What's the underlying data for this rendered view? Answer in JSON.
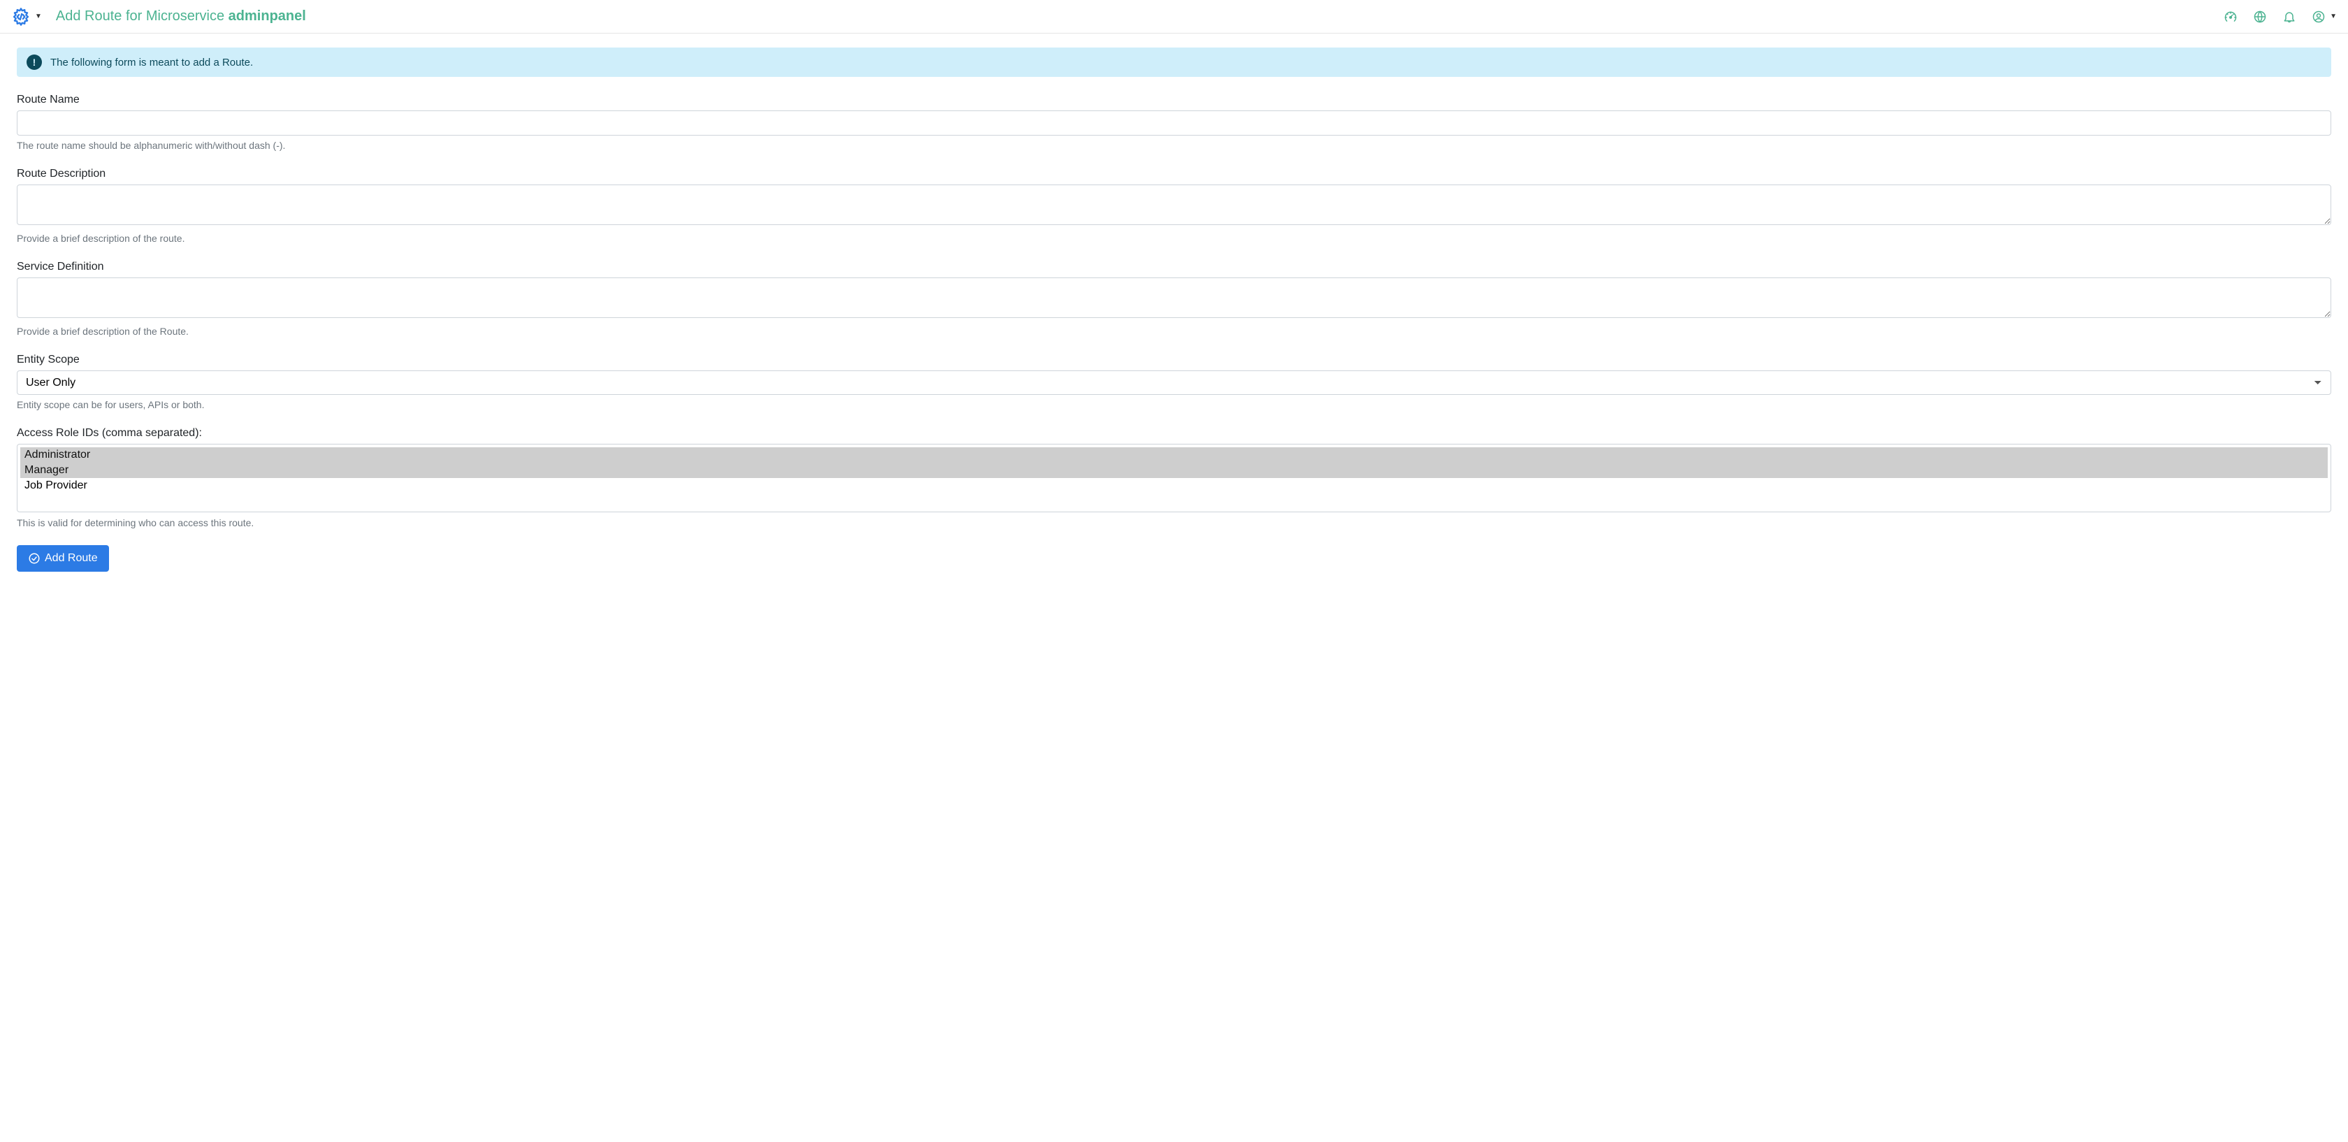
{
  "header": {
    "title_prefix": "Add Route for Microservice ",
    "title_name": "adminpanel"
  },
  "banner": {
    "text": "The following form is meant to add a Route."
  },
  "form": {
    "route_name": {
      "label": "Route Name",
      "value": "",
      "help": "The route name should be alphanumeric with/without dash (-)."
    },
    "route_description": {
      "label": "Route Description",
      "value": "",
      "help": "Provide a brief description of the route."
    },
    "service_definition": {
      "label": "Service Definition",
      "value": "",
      "help": "Provide a brief description of the Route."
    },
    "entity_scope": {
      "label": "Entity Scope",
      "selected": "User Only",
      "help": "Entity scope can be for users, APIs or both."
    },
    "access_roles": {
      "label": "Access Role IDs (comma separated):",
      "options": [
        "Administrator",
        "Manager",
        "Job Provider"
      ],
      "selected": [
        "Administrator",
        "Manager"
      ],
      "help": "This is valid for determining who can access this route."
    }
  },
  "submit": {
    "label": "Add Route"
  }
}
